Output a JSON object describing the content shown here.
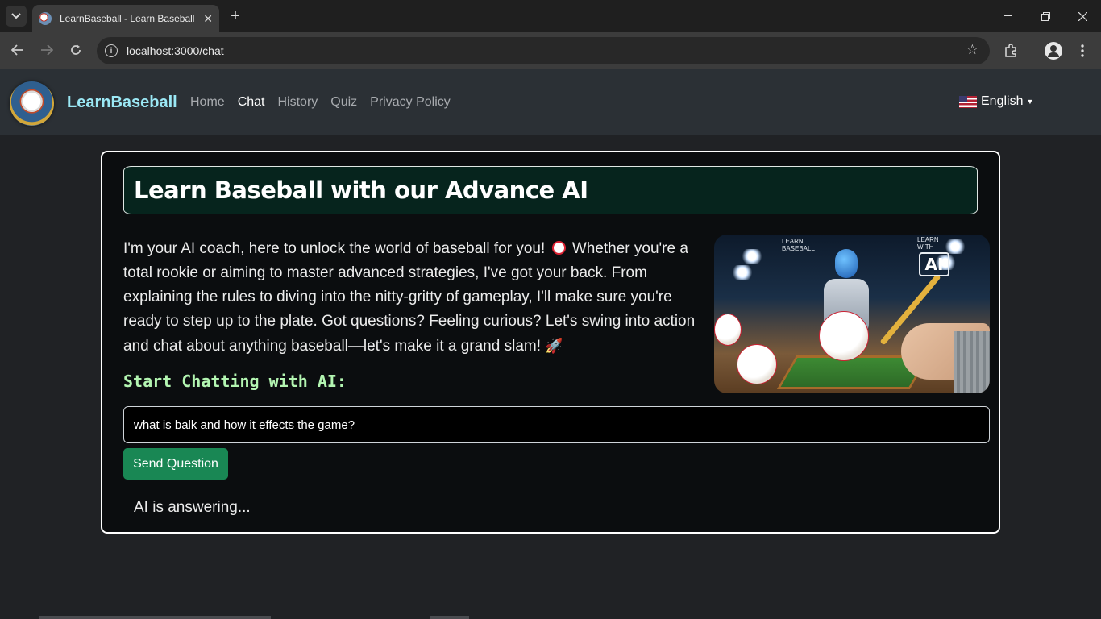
{
  "browser": {
    "tab_title": "LearnBaseball - Learn Baseball",
    "url": "localhost:3000/chat",
    "icons": [
      "tab-search-icon",
      "close-icon",
      "plus-icon",
      "minimize-icon",
      "restore-icon",
      "window-close-icon",
      "back-icon",
      "forward-icon",
      "reload-icon",
      "info-icon",
      "star-icon",
      "extensions-icon",
      "profile-icon",
      "menu-icon"
    ]
  },
  "site": {
    "brand": "LearnBaseball",
    "nav": [
      "Home",
      "Chat",
      "History",
      "Quiz",
      "Privacy Policy"
    ],
    "active_nav": "Chat",
    "language": "English"
  },
  "main": {
    "headline": "Learn Baseball with our Advance AI",
    "intro_part1": "I'm your AI coach, here to unlock the world of baseball for you!",
    "intro_part2": "Whether you're a total rookie or aiming to master advanced strategies, I've got your back. From explaining the rules to diving into the nitty-gritty of gameplay, I'll make sure you're ready to step up to the plate. Got questions? Feeling curious? Let's swing into action and chat about anything baseball—let's make it a grand slam!",
    "chat_heading": "Start Chatting with AI:",
    "input_value": "what is balk and how it effects the game?",
    "send_label": "Send Question",
    "status": "AI is answering...",
    "image_text": {
      "learn_baseball": "LEARN BASEBALL",
      "learn_with": "LEARN WITH",
      "ai": "AI"
    }
  },
  "colors": {
    "accent_green": "#198754",
    "brand_cyan": "#9be8f5",
    "heading_green": "#b3f5b1",
    "headline_bg": "#06241d"
  }
}
